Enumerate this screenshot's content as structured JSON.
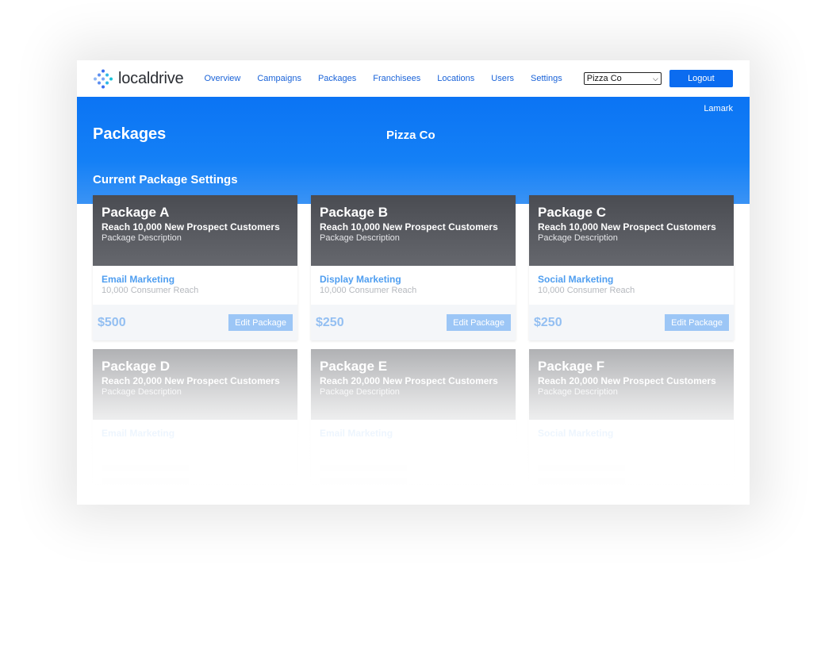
{
  "brand": {
    "name": "localdrive"
  },
  "nav": {
    "links": [
      "Overview",
      "Campaigns",
      "Packages",
      "Franchisees",
      "Locations",
      "Users",
      "Settings"
    ],
    "client_select": {
      "value": "Pizza Co"
    },
    "logout_label": "Logout"
  },
  "header": {
    "user": "Lamark",
    "page_title": "Packages",
    "client_title": "Pizza Co",
    "section_title": "Current Package Settings"
  },
  "packages": [
    {
      "name": "Package A",
      "reach": "Reach 10,000 New Prospect Customers",
      "description": "Package Description",
      "service": "Email Marketing",
      "service_reach": "10,000 Consumer Reach",
      "price": "$500",
      "edit_label": "Edit Package"
    },
    {
      "name": "Package B",
      "reach": "Reach 10,000 New Prospect Customers",
      "description": "Package Description",
      "service": "Display Marketing",
      "service_reach": "10,000 Consumer Reach",
      "price": "$250",
      "edit_label": "Edit Package"
    },
    {
      "name": "Package C",
      "reach": "Reach 10,000 New Prospect Customers",
      "description": "Package Description",
      "service": "Social Marketing",
      "service_reach": "10,000 Consumer Reach",
      "price": "$250",
      "edit_label": "Edit Package"
    },
    {
      "name": "Package D",
      "reach": "Reach 20,000 New Prospect Customers",
      "description": "Package Description",
      "service": "Email Marketing"
    },
    {
      "name": "Package E",
      "reach": "Reach 20,000 New Prospect Customers",
      "description": "Package Description",
      "service": "Email Marketing"
    },
    {
      "name": "Package F",
      "reach": "Reach 20,000 New Prospect Customers",
      "description": "Package Description",
      "service": "Social Marketing"
    }
  ],
  "colors": {
    "brand_blue": "#0b6cf0",
    "card_header": "#55575d",
    "accent_light_blue": "#4f9ef0"
  }
}
